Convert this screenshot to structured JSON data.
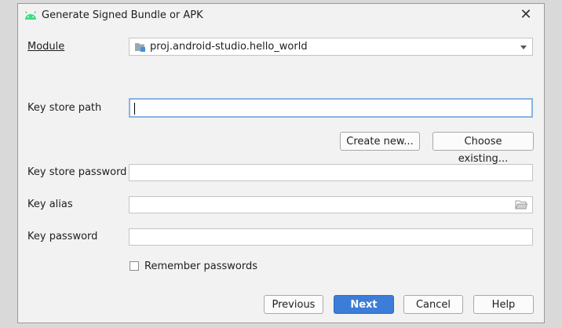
{
  "dialog": {
    "title": "Generate Signed Bundle or APK",
    "close_glyph": "✕"
  },
  "module": {
    "label": "Module",
    "value": "proj.android-studio.hello_world"
  },
  "key_store_path": {
    "label": "Key store path",
    "value": ""
  },
  "buttons": {
    "create_new": "Create new...",
    "choose_existing": "Choose existing...",
    "previous": "Previous",
    "next": "Next",
    "cancel": "Cancel",
    "help": "Help"
  },
  "key_store_password": {
    "label": "Key store password",
    "value": ""
  },
  "key_alias": {
    "label": "Key alias",
    "value": ""
  },
  "key_password": {
    "label": "Key password",
    "value": ""
  },
  "remember": {
    "label": "Remember passwords",
    "checked": false
  },
  "icons": {
    "title": "android-icon",
    "module": "module-folder-icon",
    "alias_browse": "folder-icon",
    "dropdown": "chevron-down-icon"
  },
  "colors": {
    "accent": "#3b7dd8",
    "focus_border": "#88b4e0",
    "android_green": "#3ddc84"
  }
}
